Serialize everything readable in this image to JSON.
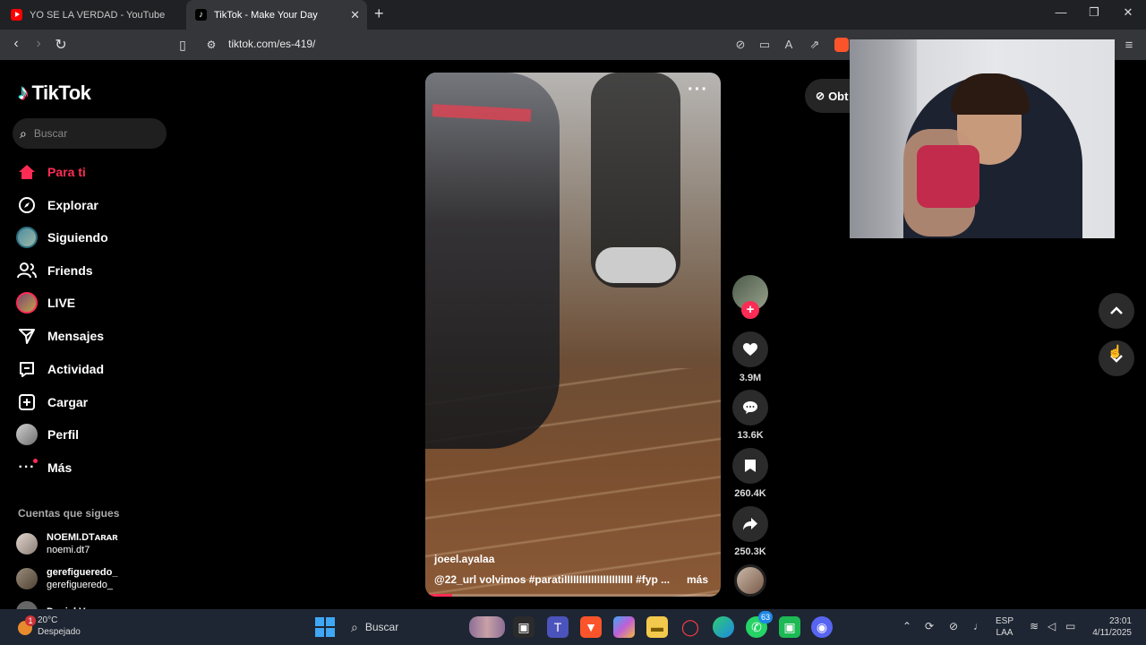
{
  "browser": {
    "tabs": [
      {
        "title": "YO SE LA VERDAD - YouTube",
        "icon": "youtube-icon"
      },
      {
        "title": "TikTok - Make Your Day",
        "icon": "tiktok-icon"
      }
    ],
    "url": "tiktok.com/es-419/"
  },
  "sidebar": {
    "logo": "TikTok",
    "search_placeholder": "Buscar",
    "nav": [
      {
        "label": "Para ti",
        "icon": "home-icon",
        "active": true
      },
      {
        "label": "Explorar",
        "icon": "compass-icon"
      },
      {
        "label": "Siguiendo",
        "icon": "following-avatar-icon"
      },
      {
        "label": "Friends",
        "icon": "friends-icon"
      },
      {
        "label": "LIVE",
        "icon": "live-avatar-icon"
      },
      {
        "label": "Mensajes",
        "icon": "send-icon"
      },
      {
        "label": "Actividad",
        "icon": "activity-icon"
      },
      {
        "label": "Cargar",
        "icon": "upload-icon"
      },
      {
        "label": "Perfil",
        "icon": "profile-avatar-icon"
      },
      {
        "label": "Más",
        "icon": "more-icon"
      }
    ],
    "following_title": "Cuentas que sigues",
    "following": [
      {
        "display": "NOEMI.DTᴀʀᴀʀ",
        "handle": "noemi.dt7"
      },
      {
        "display": "gerefigueredo_",
        "handle": "gerefigueredo_"
      },
      {
        "display": "Daniel Vega",
        "handle": ""
      }
    ]
  },
  "video": {
    "author": "joeel.ayalaa",
    "caption": "@22_url  volvimos #paratiIIIIIIIIIIIIIIIIIIIIIII  #fyp ...",
    "more": "más",
    "progress": 0.09,
    "stats": {
      "likes": "3.9M",
      "comments": "13.6K",
      "saves": "260.4K",
      "shares": "250.3K"
    }
  },
  "right": {
    "get_app_label": "Obt"
  },
  "taskbar": {
    "weather_badge": "1",
    "temperature": "20°C",
    "condition": "Despejado",
    "search": "Buscar",
    "whatsapp_badge": "63",
    "lang_top": "ESP",
    "lang_bottom": "LAA",
    "time": "23:01",
    "date": "4/11/2025"
  },
  "colors": {
    "accent": "#fe2c55",
    "background": "#000000"
  }
}
